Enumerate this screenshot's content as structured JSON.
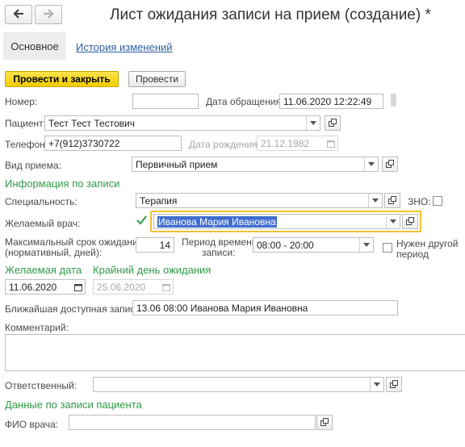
{
  "title": "Лист ожидания записи на прием (создание) *",
  "tabs": {
    "main": "Основное",
    "history": "История изменений"
  },
  "toolbar": {
    "post_close": "Провести и закрыть",
    "post": "Провести"
  },
  "fields": {
    "number_label": "Номер:",
    "number_value": "",
    "appeal_date_label": "Дата обращения:",
    "appeal_date_value": "11.06.2020 12:22:49",
    "patient_label": "Пациент:",
    "patient_value": "Тест Тест Тестович",
    "phone_label": "Телефон:",
    "phone_value": "+7(912)3730722",
    "birth_label": "Дата рождения:",
    "birth_value": "21.12.1982",
    "visit_type_label": "Вид приема:",
    "visit_type_value": "Первичный прием"
  },
  "section_booking": {
    "heading": "Информация по записи",
    "specialty_label": "Специальность:",
    "specialty_value": "Терапия",
    "zno_label": "ЗНО:",
    "zno_checked": false,
    "doctor_label": "Желаемый врач:",
    "doctor_checked": true,
    "doctor_value": "Иванова Мария Ивановна",
    "max_wait_label_1": "Максимальный срок ожидания",
    "max_wait_label_2": "(нормативный, дней):",
    "max_wait_value": "14",
    "period_label_1": "Период времени",
    "period_label_2": "записи:",
    "period_value": "08:00 - 20:00",
    "other_period_label_1": "Нужен другой",
    "other_period_label_2": "период",
    "other_period_checked": false,
    "desired_date_heading": "Желаемая дата",
    "desired_date_value": "11.06.2020",
    "deadline_heading": "Крайний день ожидания",
    "deadline_value": "25.06.2020",
    "nearest_label": "Ближайшая доступная запись:",
    "nearest_value": "13.06 08:00 Иванова Мария Ивановна",
    "comment_label": "Комментарий:",
    "comment_value": "",
    "responsible_label": "Ответственный:",
    "responsible_value": ""
  },
  "section_patient": {
    "heading": "Данные по записи пациента",
    "doctor_name_label": "ФИО врача:",
    "doctor_name_value": ""
  }
}
